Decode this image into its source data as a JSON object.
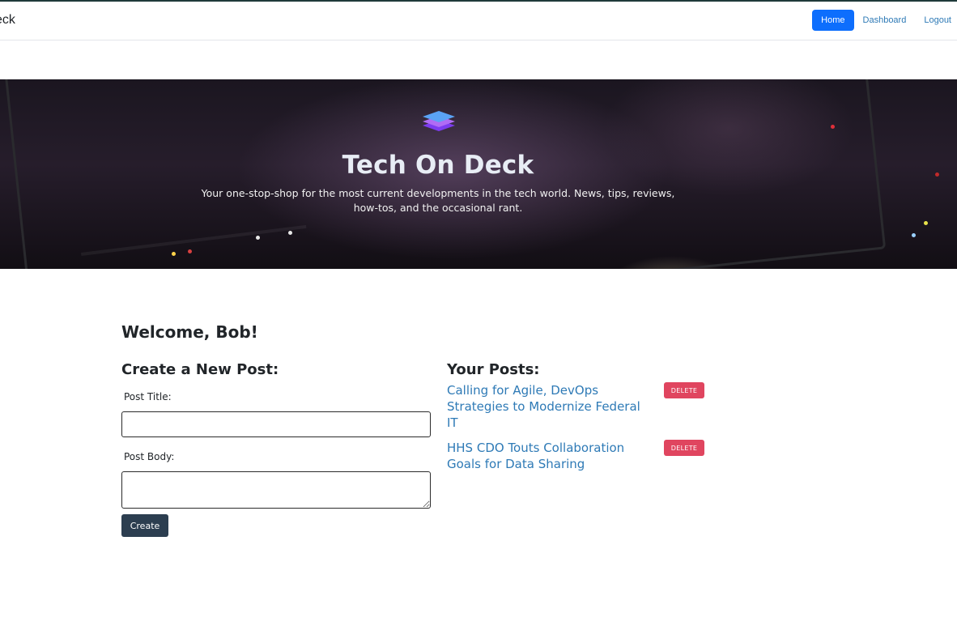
{
  "navbar": {
    "brand": "eck",
    "links": [
      "Home",
      "Dashboard",
      "Logout"
    ]
  },
  "hero": {
    "title": "Tech On Deck",
    "subtitle": "Your one-stop-shop for the most current developments in the tech world. News, tips, reviews, how-tos, and the occasional rant."
  },
  "main": {
    "welcome": "Welcome, Bob!",
    "create": {
      "heading": "Create a New Post:",
      "title_label": "Post Title:",
      "title_value": "",
      "body_label": "Post Body:",
      "body_value": "",
      "button": "Create"
    },
    "posts": {
      "heading": "Your Posts:",
      "items": [
        {
          "title": "Calling for Agile, DevOps Strategies to Modernize Federal IT",
          "delete": "DELETE"
        },
        {
          "title": "HHS CDO Touts Collaboration Goals for Data Sharing",
          "delete": "DELETE"
        }
      ]
    }
  },
  "colors": {
    "primary": "#0d6efd",
    "link": "#2e7ab6",
    "delete": "#e0455f",
    "create_button": "#2c3e50"
  }
}
